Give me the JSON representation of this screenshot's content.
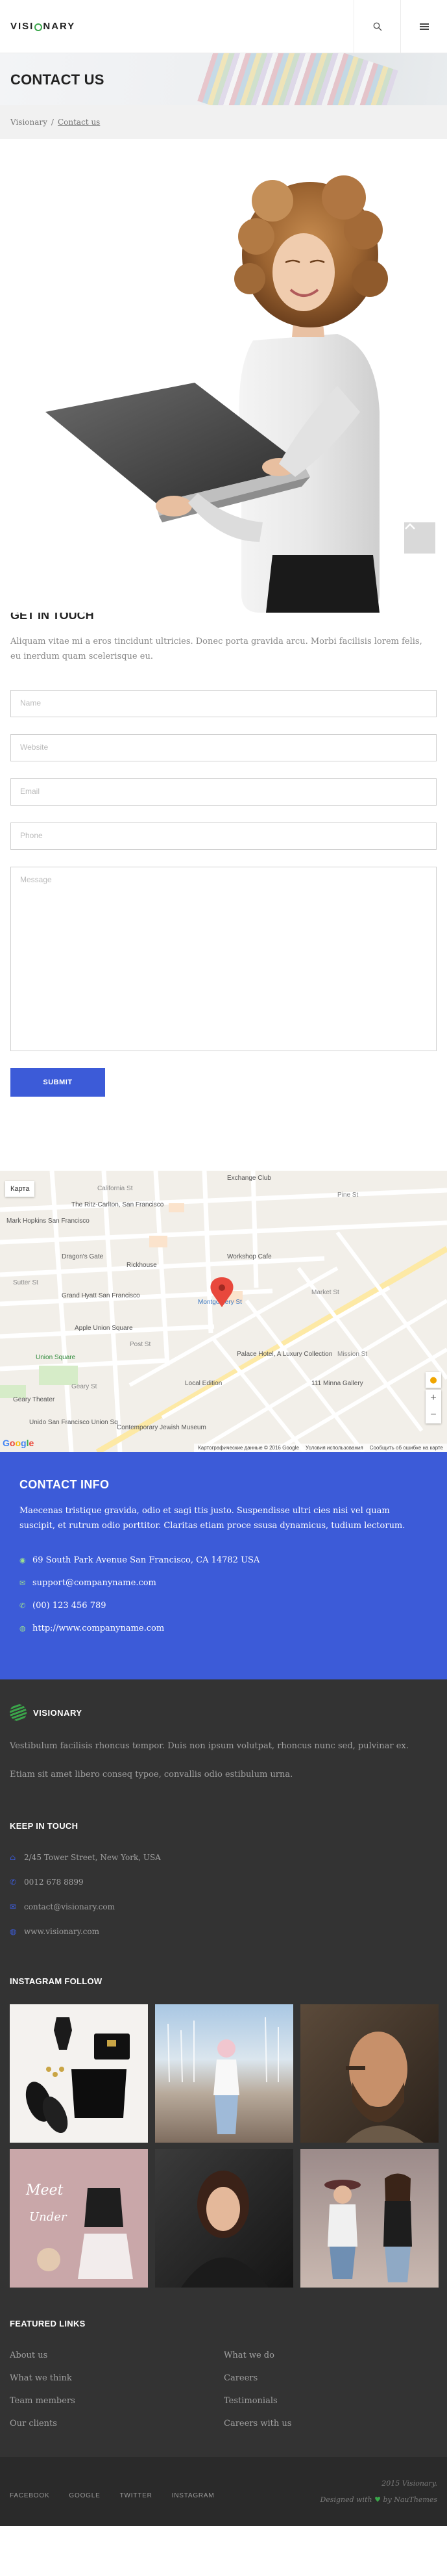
{
  "header": {
    "logo_pre": "VISI",
    "logo_post": "NARY",
    "search_icon": "search-icon",
    "menu_icon": "menu-icon"
  },
  "banner": {
    "title": "CONTACT US"
  },
  "breadcrumb": {
    "home": "Visionary",
    "separator": "/",
    "current": "Contact us"
  },
  "get_in_touch": {
    "title": "GET IN TOUCH",
    "text": "Aliquam vitae mi a eros tincidunt ultricies. Donec porta gravida arcu. Morbi facilisis lorem felis, eu inerdum quam scelerisque eu."
  },
  "form": {
    "name_placeholder": "Name",
    "website_placeholder": "Website",
    "email_placeholder": "Email",
    "phone_placeholder": "Phone",
    "message_placeholder": "Message",
    "submit": "SUBMIT"
  },
  "map": {
    "karta": "Карта",
    "streets": [
      "Exchange Club",
      "The Ritz-Carlton, San Francisco",
      "Mark Hopkins San Francisco",
      "Dragon's Gate",
      "Rickhouse",
      "Workshop Cafe",
      "Grand Hyatt San Francisco",
      "Montgomery St",
      "Apple Union Square",
      "Union Square",
      "Palace Hotel, A Luxury Collection",
      "Local Edition",
      "Geary Theater",
      "111 Minna Gallery",
      "Contemporary Jewish Museum",
      "Unido San Francisco Union Sq",
      "Pine St",
      "California St",
      "Sutter St",
      "Post St",
      "Geary St",
      "Market St",
      "Mission St"
    ],
    "attribution": [
      "Картографические данные © 2016 Google",
      "Условия использования",
      "Сообщить об ошибке на карте"
    ],
    "google": "Google"
  },
  "contact_info": {
    "title": "CONTACT INFO",
    "text": "Maecenas tristique gravida, odio et sagi ttis justo. Suspendisse ultri cies nisi vel quam suscipit, et rutrum odio porttitor. Claritas etiam proce ssusa dynamicus, tudium lectorum.",
    "address": "69 South Park Avenue San Francisco, CA 14782 USA",
    "email": "support@companyname.com",
    "phone": "(00) 123 456 789",
    "website": "http://www.companyname.com"
  },
  "footer": {
    "logo": "VISIONARY",
    "text1": "Vestibulum facilisis rhoncus tempor. Duis non ipsum volutpat, rhoncus nunc sed, pulvinar ex.",
    "text2": "Etiam sit amet libero conseq typoe, convallis odio estibulum urna.",
    "keep_title": "KEEP IN TOUCH",
    "address": "2/45 Tower Street, New York, USA",
    "phone": "0012 678 8899",
    "email": "contact@visionary.com",
    "web": "www.visionary.com",
    "instagram_title": "INSTAGRAM FOLLOW",
    "links_title": "FEATURED LINKS",
    "links": [
      "About us",
      "What we do",
      "What we think",
      "Careers",
      "Team members",
      "Testimonials",
      "Our clients",
      "Careers with us"
    ],
    "social": [
      "FACEBOOK",
      "GOOGLE",
      "TWITTER",
      "INSTAGRAM"
    ],
    "copy1": "2015 Visionary.",
    "copy2_pre": "Designed with",
    "copy2_post": "by NauThemes"
  },
  "colors": {
    "accent": "#3c5bd8",
    "green": "#3aa64a",
    "footer_bg": "#333333"
  }
}
